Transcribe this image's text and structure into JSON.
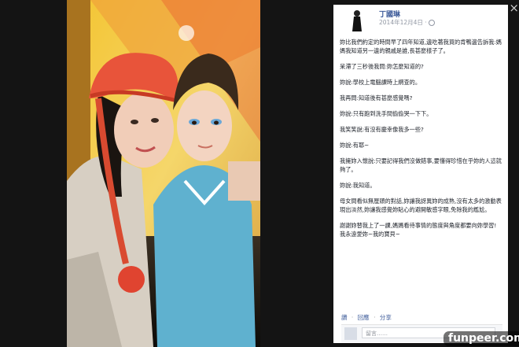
{
  "post": {
    "author": "丁國琳",
    "time": "2014年12月4日 · ",
    "paragraphs": [
      "妳比我們約定的時間早了四年知道,邊吃著我買的肯鴨邊告訴我:媽媽我知道另一邊的親戚是誰,長甚麼樣子了。",
      "呆滯了三秒後我問:妳怎麼知道的?",
      "妳說:學校上電腦課時上網查的。",
      "我再問:知道後有甚麼感覺嗎?",
      "妳說:只有跑到洗手間偷偷哭一下下。",
      "我笑笑說:有沒有慶幸像我多一些?",
      "妳說:有耶~",
      "我擁妳入懷說:只要記得我們沒做錯事,要懂得珍惜在乎妳的人這就夠了。",
      "妳說:我知道。",
      "母女間看似無厘頭的對話,妳讓我訝異妳的成熟,沒有太多的激動表現出淡然,妳讓我感覺妳貼心的避開敏感字眼,免除我的尷尬。",
      "謝謝妳替我上了一課,媽媽看待事情的態度與角度都要向妳學習!\n我永遠愛妳~我的寶貝~"
    ],
    "actions": {
      "like": "讚",
      "comment": "回應",
      "share": "分享",
      "sep": "·"
    },
    "comment_placeholder": "留言……"
  },
  "close_icon": "×",
  "watermark": "funpeer.com"
}
